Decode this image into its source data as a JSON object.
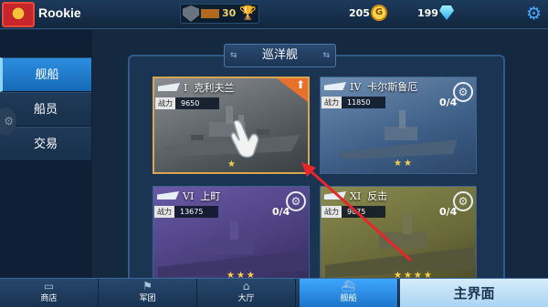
{
  "header": {
    "player_name": "Rookie",
    "rank_value": "30",
    "gold": "205",
    "gold_symbol": "G",
    "gems": "199"
  },
  "sidebar": {
    "items": [
      {
        "label": "舰船",
        "active": true
      },
      {
        "label": "船员",
        "active": false
      },
      {
        "label": "交易",
        "active": false
      }
    ]
  },
  "category": {
    "label": "巡洋舰"
  },
  "ships": [
    {
      "tier": "I",
      "name": "克利夫兰",
      "power_label": "战力",
      "power": "9650",
      "stars": 1,
      "slots": "",
      "upgrade": true,
      "selected": true,
      "color": "#6a6e72"
    },
    {
      "tier": "IV",
      "name": "卡尔斯鲁厄",
      "power_label": "战力",
      "power": "11850",
      "stars": 2,
      "slots": "0/4",
      "upgrade": false,
      "selected": false,
      "color": "#3d5e86"
    },
    {
      "tier": "VI",
      "name": "上町",
      "power_label": "战力",
      "power": "13675",
      "stars": 3,
      "slots": "0/4",
      "upgrade": false,
      "selected": false,
      "color": "#4b3f7e"
    },
    {
      "tier": "XI",
      "name": "反击",
      "power_label": "战力",
      "power": "9075",
      "stars": 4,
      "slots": "0/4",
      "upgrade": false,
      "selected": false,
      "color": "#6a6a3a"
    }
  ],
  "bottom_nav": [
    {
      "label": "商店",
      "active": false
    },
    {
      "label": "军团",
      "active": false
    },
    {
      "label": "大厅",
      "active": false
    },
    {
      "label": "舰船",
      "active": true
    }
  ],
  "main_button": "主界面",
  "colors": {
    "accent": "#1c74c8",
    "upgrade": "#e8702a",
    "tutorial_arrow": "#e8262a",
    "star": "#f6d24a"
  },
  "icons": {
    "rank": "shield-icon",
    "trophy": "trophy-icon",
    "gold": "gold-coin-icon",
    "gem": "diamond-icon",
    "settings": "gear-icon",
    "module": "gear-module-icon",
    "upgrade": "upgrade-arrow-icon",
    "tutorial": "pointing-hand-icon"
  }
}
